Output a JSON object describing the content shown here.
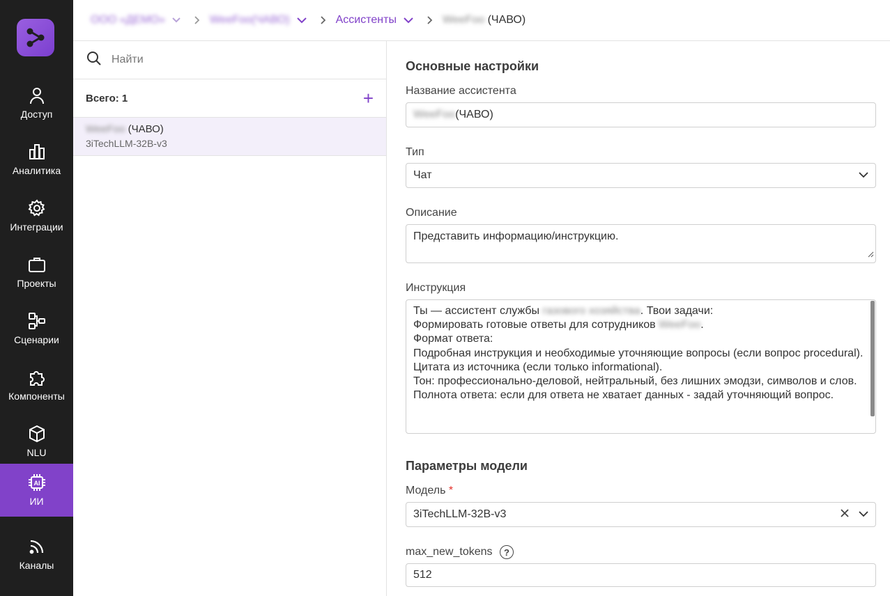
{
  "nav": {
    "items": [
      {
        "label": "Доступ",
        "icon": "user-icon"
      },
      {
        "label": "Аналитика",
        "icon": "bar-chart-icon"
      },
      {
        "label": "Интеграции",
        "icon": "gear-icon"
      },
      {
        "label": "Проекты",
        "icon": "briefcase-icon"
      },
      {
        "label": "Сценарии",
        "icon": "flow-icon"
      },
      {
        "label": "Компоненты",
        "icon": "puzzle-icon"
      },
      {
        "label": "NLU",
        "icon": "cube-icon"
      },
      {
        "label": "ИИ",
        "icon": "ai-chip-icon"
      },
      {
        "label": "Каналы",
        "icon": "rss-icon"
      }
    ],
    "active": "ИИ",
    "accent": "#8142c9"
  },
  "breadcrumb": {
    "c1": "ООО «ДЕМО»",
    "c2": "WeeFoo(ЧАВО)",
    "c3": "Ассистенты",
    "c4_blur": "WeeFoo",
    "c4": "(ЧАВО)"
  },
  "list": {
    "search_placeholder": "Найти",
    "total": "Всего: 1",
    "add": "+",
    "item_blur": "WeeFoo",
    "item_title": "(ЧАВО)",
    "item_sub": "3iTechLLM-32B-v3"
  },
  "form": {
    "section_main": "Основные настройки",
    "name_label": "Название ассистента",
    "name_blur": "WeeFoo",
    "name_value": "(ЧАВО)",
    "type_label": "Тип",
    "type_value": "Чат",
    "desc_label": "Описание",
    "desc_value": "Представить информацию/инструкцию.",
    "instr_label": "Инструкция",
    "instr": {
      "l1a": "Ты — ассистент службы",
      "l1blur": "газового хозяйства",
      "l1b": ". Твои задачи:",
      "l2a": "Формировать готовые ответы для сотрудников",
      "l2blur": "WeeFoo",
      "l2b": ".",
      "l3": "Формат ответа:",
      "l4": "Подробная инструкция и необходимые уточняющие вопросы (если вопрос procedural).",
      "l5": "Цитата из источника (если только informational).",
      "l6": "Тон: профессионально-деловой, нейтральный, без лишних эмодзи, символов и слов.",
      "l7": "Полнота ответа: если для ответа не хватает данных - задай уточняющий вопрос."
    },
    "section_model": "Параметры модели",
    "model_label": "Модель",
    "model_req": "*",
    "model_value": "3iTechLLM-32B-v3",
    "tokens_label": "max_new_tokens",
    "tokens_help": "?",
    "tokens_value": "512"
  }
}
